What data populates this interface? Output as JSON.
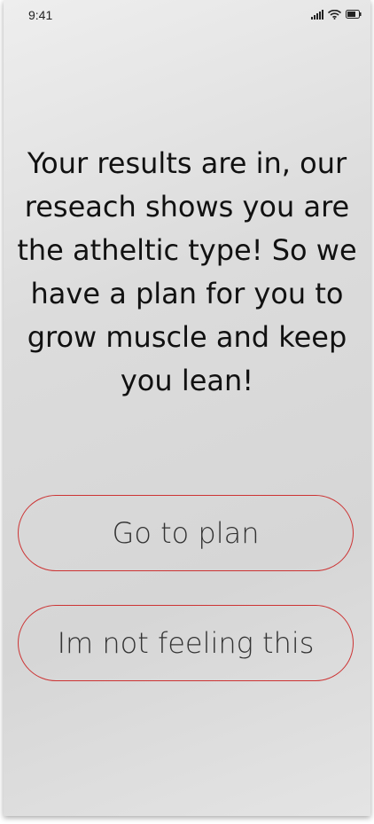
{
  "status_bar": {
    "time": "9:41",
    "icons": [
      "cellular-signal-icon",
      "wifi-icon",
      "battery-icon"
    ]
  },
  "main": {
    "message": "Your results are in, our reseach shows you are the atheltic type! So we have a plan for you to grow muscle and keep you lean!"
  },
  "actions": {
    "primary_label": "Go to plan",
    "secondary_label": "Im not feeling this"
  },
  "colors": {
    "button_border": "#cc3333",
    "text": "#111111"
  }
}
